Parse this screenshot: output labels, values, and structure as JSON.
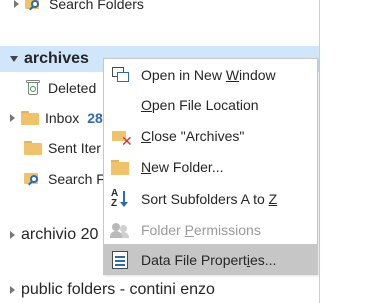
{
  "pane": {
    "search_folders_top": "Search Folders",
    "archives": {
      "label": "archives"
    },
    "archive_items": [
      {
        "label": "Deleted"
      },
      {
        "label": "Inbox",
        "count": "28"
      },
      {
        "label": "Sent Iter"
      },
      {
        "label": "Search F"
      }
    ],
    "archivio": "archivio 20",
    "public_folders": "public folders - contini enzo"
  },
  "context_menu": {
    "items": [
      {
        "pre": "Open in New ",
        "key": "W",
        "post": "indow",
        "icon": "open-new-window-icon",
        "state": "normal"
      },
      {
        "pre": "",
        "key": "O",
        "post": "pen File Location",
        "icon": "none",
        "state": "normal"
      },
      {
        "pre": "",
        "key": "C",
        "post": "lose \"Archives\"",
        "icon": "close-folder-icon",
        "state": "normal"
      },
      {
        "pre": "",
        "key": "N",
        "post": "ew Folder...",
        "icon": "new-folder-icon",
        "state": "normal"
      },
      {
        "pre": "Sort Subfolders A to ",
        "key": "Z",
        "post": "",
        "icon": "sort-az-icon",
        "state": "normal"
      },
      {
        "pre": "Folder ",
        "key": "P",
        "post": "ermissions",
        "icon": "permissions-icon",
        "state": "disabled"
      },
      {
        "pre": "Data File Propert",
        "key": "i",
        "post": "es...",
        "icon": "data-file-properties-icon",
        "state": "hover"
      }
    ]
  },
  "colors": {
    "selected_band": "#cfe6fb",
    "menu_hover": "#c6c6c6",
    "count_blue": "#2b6cb0"
  }
}
